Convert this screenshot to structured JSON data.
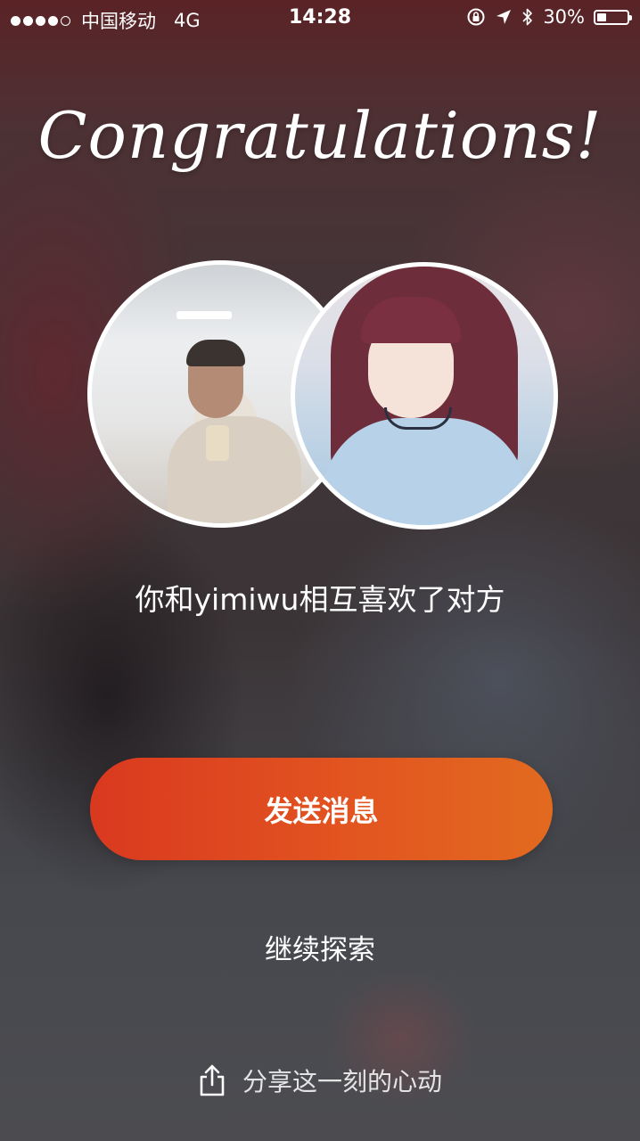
{
  "status_bar": {
    "carrier": "中国移动",
    "network": "4G",
    "time": "14:28",
    "battery_percent": "30%",
    "battery_level": 0.3,
    "signal_bars_filled": 4,
    "signal_bars_total": 5,
    "icons": [
      "rotation-lock-icon",
      "location-icon",
      "bluetooth-icon",
      "battery-icon"
    ]
  },
  "match": {
    "title": "Congratulations!",
    "message": "你和yimiwu相互喜欢了对方",
    "avatars": [
      "my-avatar",
      "match-avatar"
    ]
  },
  "actions": {
    "send_message": "发送消息",
    "keep_exploring": "继续探索",
    "share_label": "分享这一刻的心动"
  },
  "colors": {
    "button_start": "#d9391f",
    "button_end": "#e26a1f",
    "text": "#ffffff"
  }
}
